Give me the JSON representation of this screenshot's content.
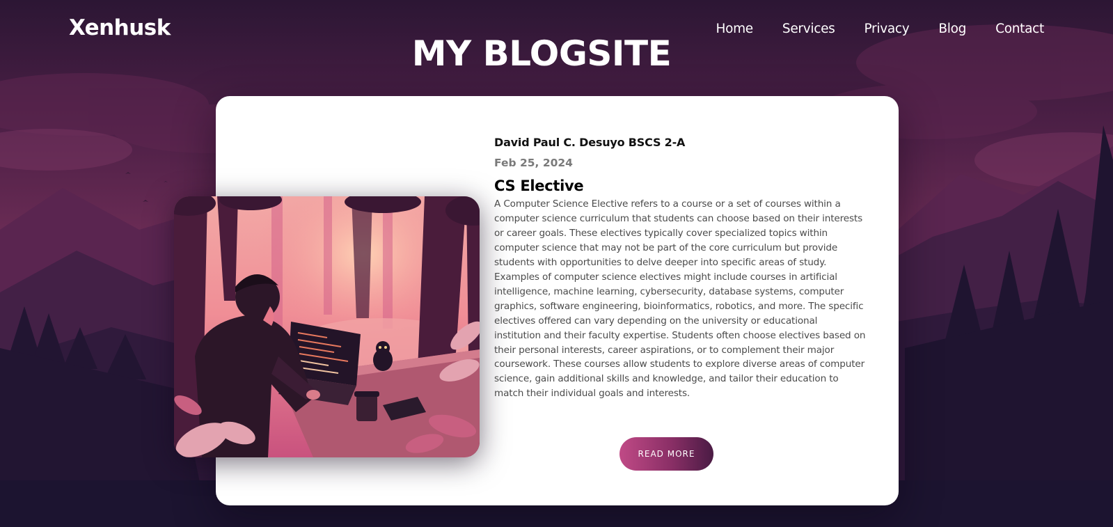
{
  "brand": "Xenhusk",
  "nav": {
    "items": [
      "Home",
      "Services",
      "Privacy",
      "Blog",
      "Contact"
    ]
  },
  "site_title": "MY BLOGSITE",
  "post": {
    "author": "David Paul C. Desuyo BSCS 2-A",
    "date": "Feb 25, 2024",
    "title": "CS Elective",
    "body": "A Computer Science Elective refers to a course or a set of courses within a computer science curriculum that students can choose based on their interests or career goals. These electives typically cover specialized topics within computer science that may not be part of the core curriculum but provide students with opportunities to delve deeper into specific areas of study. Examples of computer science electives might include courses in artificial intelligence, machine learning, cybersecurity, database systems, computer graphics, software engineering, bioinformatics, robotics, and more. The specific electives offered can vary depending on the university or educational institution and their faculty expertise. Students often choose electives based on their personal interests, career aspirations, or to complement their major coursework. These courses allow students to explore diverse areas of computer science, gain additional skills and knowledge, and tailor their education to match their individual goals and interests.",
    "read_more_label": "READ MORE"
  },
  "colors": {
    "sky_top": "#2c1634",
    "sky_mid": "#6b2c55",
    "card_bg": "#ffffff",
    "button_start": "#c04a86",
    "button_end": "#4a1b44"
  },
  "icons": {
    "hero_image": "person-coding-laptop-forest-illustration"
  }
}
